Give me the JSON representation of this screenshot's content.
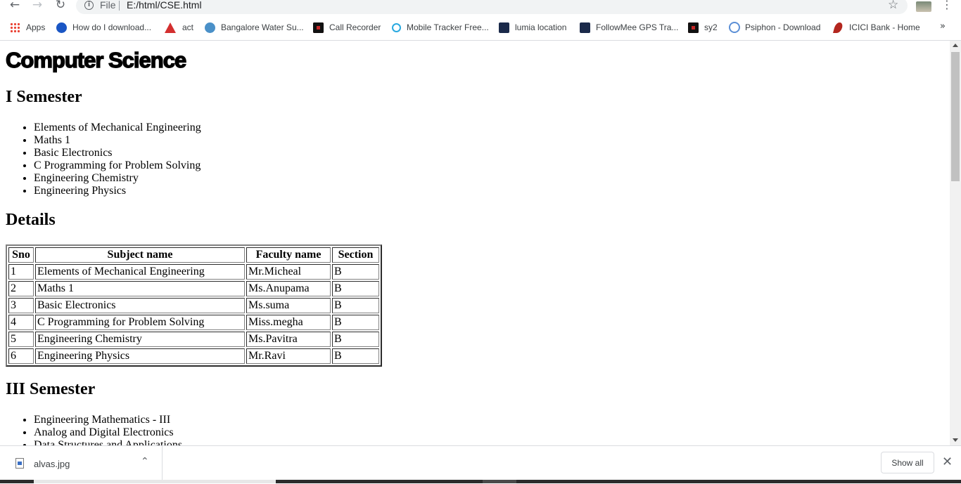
{
  "browser": {
    "url_scheme": "File",
    "url": "E:/html/CSE.html",
    "nav": {
      "back_icon": "arrow-left-icon",
      "forward_icon": "arrow-right-icon",
      "reload_icon": "reload-icon"
    },
    "bookmarks": [
      {
        "label": "Apps",
        "icon": "apps-grid-icon"
      },
      {
        "label": "How do I download...",
        "icon": "help-icon"
      },
      {
        "label": "act",
        "icon": "act-logo-icon"
      },
      {
        "label": "Bangalore Water Su...",
        "icon": "globe-icon"
      },
      {
        "label": "Call Recorder",
        "icon": "call-recorder-icon"
      },
      {
        "label": "Mobile Tracker Free...",
        "icon": "mobile-tracker-icon"
      },
      {
        "label": "lumia location",
        "icon": "lumia-location-icon"
      },
      {
        "label": "FollowMee GPS Tra...",
        "icon": "followmee-icon"
      },
      {
        "label": "sy2",
        "icon": "sy2-icon"
      },
      {
        "label": "Psiphon - Download",
        "icon": "psiphon-icon"
      },
      {
        "label": "ICICI Bank - Home",
        "icon": "icici-icon"
      }
    ],
    "bookmarks_more": "»"
  },
  "page": {
    "title": "Computer Science",
    "sem1": {
      "heading": "I Semester",
      "subjects": [
        "Elements of Mechanical Engineering",
        "Maths 1",
        "Basic Electronics",
        "C Programming for Problem Solving",
        "Engineering Chemistry",
        "Engineering Physics"
      ]
    },
    "details": {
      "heading": "Details",
      "headers": [
        "Sno",
        "Subject name",
        "Faculty name",
        "Section"
      ],
      "rows": [
        [
          "1",
          "Elements of Mechanical Engineering",
          "Mr.Micheal",
          "B"
        ],
        [
          "2",
          "Maths 1",
          "Ms.Anupama",
          "B"
        ],
        [
          "3",
          "Basic Electronics",
          "Ms.suma",
          "B"
        ],
        [
          "4",
          "C Programming for Problem Solving",
          "Miss.megha",
          "B"
        ],
        [
          "5",
          "Engineering Chemistry",
          "Ms.Pavitra",
          "B"
        ],
        [
          "6",
          "Engineering Physics",
          "Mr.Ravi",
          "B"
        ]
      ]
    },
    "sem3": {
      "heading": "III Semester",
      "subjects": [
        "Engineering Mathematics - III",
        "Analog and Digital Electronics",
        "Data Structures and Applications"
      ]
    }
  },
  "downloads": {
    "file_name": "alvas.jpg",
    "show_all_label": "Show all"
  }
}
